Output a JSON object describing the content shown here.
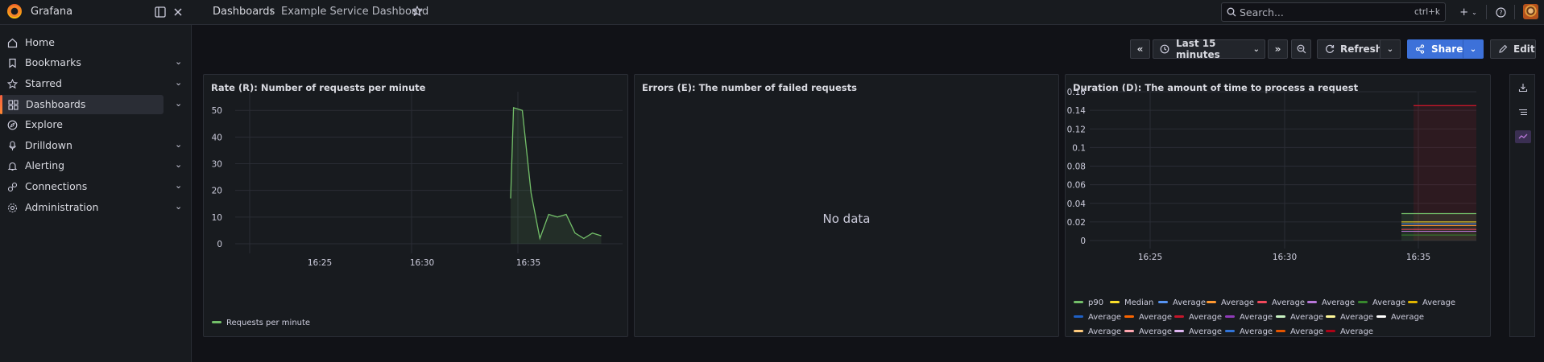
{
  "app": {
    "name": "Grafana"
  },
  "breadcrumb": {
    "root": "Dashboards",
    "separator": "›",
    "current": "Example Service Dashboard"
  },
  "search": {
    "placeholder": "Search...",
    "shortcut": "ctrl+k"
  },
  "topbar_icons": [
    "dock-icon",
    "close-icon",
    "star-icon",
    "plus-icon",
    "help-icon",
    "avatar"
  ],
  "nav": [
    {
      "label": "Home",
      "icon": "home-icon",
      "chevron": false,
      "active": false
    },
    {
      "label": "Bookmarks",
      "icon": "bookmark-icon",
      "chevron": true,
      "active": false
    },
    {
      "label": "Starred",
      "icon": "star-icon",
      "chevron": true,
      "active": false
    },
    {
      "label": "Dashboards",
      "icon": "dashboards-icon",
      "chevron": true,
      "active": true
    },
    {
      "label": "Explore",
      "icon": "compass-icon",
      "chevron": false,
      "active": false
    },
    {
      "label": "Drilldown",
      "icon": "drilldown-icon",
      "chevron": true,
      "active": false
    },
    {
      "label": "Alerting",
      "icon": "bell-icon",
      "chevron": true,
      "active": false
    },
    {
      "label": "Connections",
      "icon": "connections-icon",
      "chevron": true,
      "active": false
    },
    {
      "label": "Administration",
      "icon": "gear-icon",
      "chevron": true,
      "active": false
    }
  ],
  "toolbar": {
    "time_range": "Last 15 minutes",
    "refresh_label": "Refresh",
    "share_label": "Share",
    "edit_label": "Edit"
  },
  "colors": {
    "accent": "#3d71d9",
    "brand": "#f55f3e",
    "series_green": "#73bf69",
    "threshold_red": "#f2495c"
  },
  "panels": {
    "rate": {
      "title": "Rate (R): Number of requests per minute",
      "legend": [
        {
          "name": "Requests per minute",
          "color": "#73bf69"
        }
      ]
    },
    "errors": {
      "title": "Errors (E): The number of failed requests",
      "no_data": "No data"
    },
    "duration": {
      "title": "Duration (D): The amount of time to process a request",
      "legend": [
        {
          "name": "p90",
          "color": "#73bf69"
        },
        {
          "name": "Median",
          "color": "#fade2a"
        },
        {
          "name": "Average",
          "color": "#5794f2"
        },
        {
          "name": "Average",
          "color": "#ff9830"
        },
        {
          "name": "Average",
          "color": "#f2495c"
        },
        {
          "name": "Average",
          "color": "#b877d9"
        },
        {
          "name": "Average",
          "color": "#37872d"
        },
        {
          "name": "Average",
          "color": "#e0b400"
        },
        {
          "name": "Average",
          "color": "#1f60c4"
        },
        {
          "name": "Average",
          "color": "#fa6400"
        },
        {
          "name": "Average",
          "color": "#c4162a"
        },
        {
          "name": "Average",
          "color": "#8f3bb8"
        },
        {
          "name": "Average",
          "color": "#c8f2c2"
        },
        {
          "name": "Average",
          "color": "#fff899"
        },
        {
          "name": "Average",
          "color": "#ffffff"
        },
        {
          "name": "Average",
          "color": "#ffcb7d"
        },
        {
          "name": "Average",
          "color": "#ffa6b0"
        },
        {
          "name": "Average",
          "color": "#deb6f2"
        },
        {
          "name": "Average",
          "color": "#3274d9"
        },
        {
          "name": "Average",
          "color": "#e55400"
        },
        {
          "name": "Average",
          "color": "#ad0317"
        }
      ]
    }
  },
  "chart_data": [
    {
      "type": "area",
      "x": [
        "16:22",
        "16:23",
        "16:24",
        "16:25",
        "16:26",
        "16:27",
        "16:28",
        "16:29",
        "16:30",
        "16:31",
        "16:32",
        "16:33",
        "16:34",
        "16:34",
        "16:34.3",
        "16:34.6",
        "16:35",
        "16:35.3",
        "16:35.6",
        "16:36",
        "16:36.3",
        "16:36.6",
        "16:37",
        "16:37.3"
      ],
      "series": [
        {
          "name": "Requests per minute",
          "values": [
            null,
            null,
            null,
            null,
            null,
            null,
            null,
            null,
            null,
            null,
            null,
            null,
            null,
            17,
            51,
            50,
            19,
            2,
            11,
            10,
            11,
            4,
            2,
            4
          ]
        }
      ],
      "xticks": [
        "16:25",
        "16:30",
        "16:35"
      ],
      "yticks": [
        0,
        10,
        20,
        30,
        40,
        50
      ],
      "ylim": [
        0,
        57
      ]
    },
    {
      "type": "line",
      "xticks": [
        "16:25",
        "16:30",
        "16:35"
      ],
      "yticks": [
        0,
        0.02,
        0.04,
        0.06,
        0.08,
        0.1,
        0.12,
        0.14,
        0.16
      ],
      "ylim": [
        0,
        0.16
      ],
      "series_summary": [
        {
          "name": "p90",
          "value": 0.029
        },
        {
          "name": "Median",
          "value": 0.02
        },
        {
          "name": "Average",
          "value": 0.018
        },
        {
          "name": "Average",
          "value": 0.012
        },
        {
          "name": "Average",
          "value": 0.145
        }
      ]
    }
  ]
}
